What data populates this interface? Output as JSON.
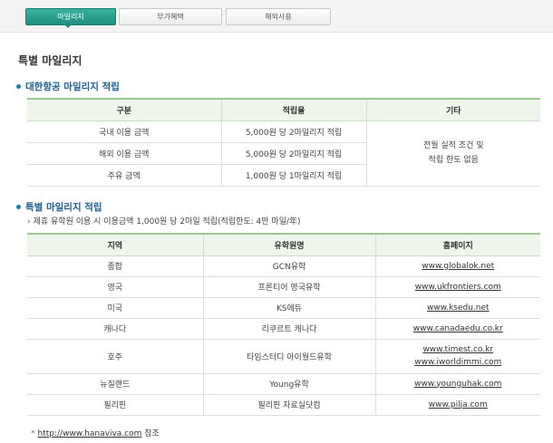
{
  "tabs": [
    {
      "label": "마일리지",
      "active": true
    },
    {
      "label": "부가혜택",
      "active": false
    },
    {
      "label": "해외사용",
      "active": false
    }
  ],
  "page_title": "특별 마일리지",
  "section1": {
    "heading": "대한항공 마일리지 적립",
    "headers": [
      "구분",
      "적립율",
      "기타"
    ],
    "rows": [
      {
        "type": "국내 이용 금액",
        "rate": "5,000원 당 2마일리지 적립"
      },
      {
        "type": "해외 이용 금액",
        "rate": "5,000원 당 2마일리지 적립"
      },
      {
        "type": "주유 금액",
        "rate": "1,000원 당 1마일리지 적립"
      }
    ],
    "etc_line1": "전월 실적 조건 및",
    "etc_line2": "적립 한도 없음"
  },
  "section2": {
    "heading": "특별 마일리지 적립",
    "note": "제휴 유학원 이용 시 이용금액 1,000원 당 2마일 적립(적립한도: 4만 마일/年)",
    "headers": [
      "지역",
      "유학원명",
      "홈페이지"
    ],
    "rows": [
      {
        "region": "종합",
        "name": "GCN유학",
        "links": [
          "www.globalok.net"
        ]
      },
      {
        "region": "영국",
        "name": "프론티어 영국유학",
        "links": [
          "www.ukfrontiers.com"
        ]
      },
      {
        "region": "미국",
        "name": "KS에듀",
        "links": [
          "www.ksedu.net"
        ]
      },
      {
        "region": "캐나다",
        "name": "리쿠르트 캐나다",
        "links": [
          "www.canadaedu.co.kr"
        ]
      },
      {
        "region": "호주",
        "name": "타임스터디 아이월드유학",
        "links": [
          "www.timest.co.kr",
          "www.iworldimmi.com"
        ]
      },
      {
        "region": "뉴질랜드",
        "name": "Young유학",
        "links": [
          "www.younguhak.com"
        ]
      },
      {
        "region": "필리핀",
        "name": "필리핀 자료실닷컴",
        "links": [
          "www.pilja.com"
        ]
      }
    ]
  },
  "footer": {
    "link": "http://www.hanaviva.com",
    "suffix": "참조"
  },
  "colors": {
    "accent": "#1f8f7c",
    "heading": "#1d5f92",
    "table_header_bg": "#eef6ec",
    "table_header_border": "#9bc88e"
  }
}
